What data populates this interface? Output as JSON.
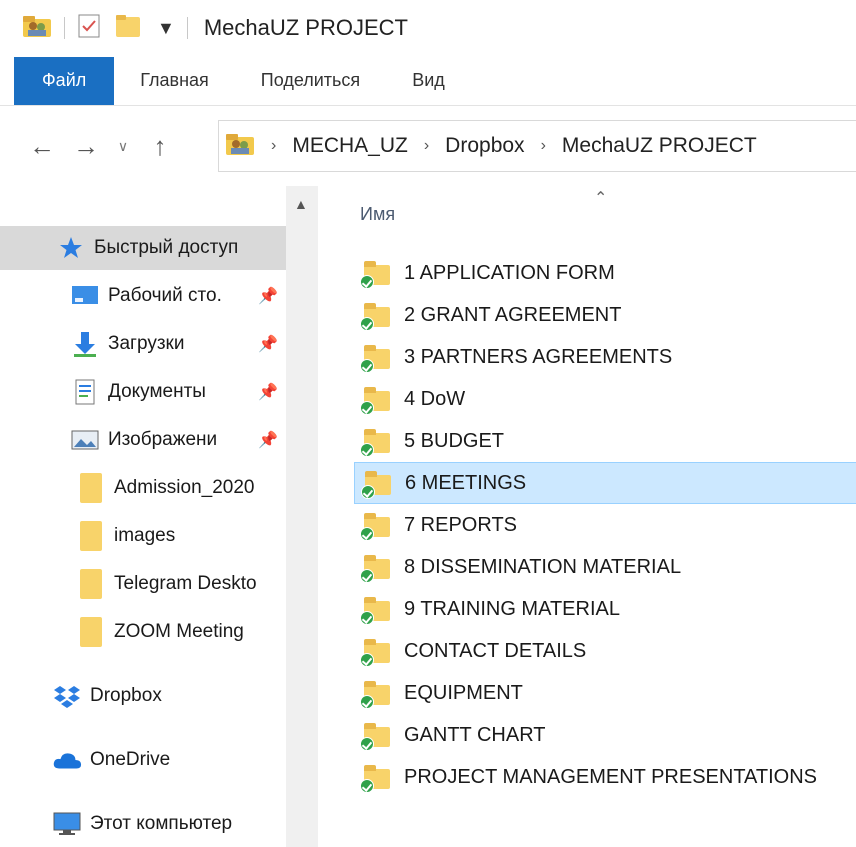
{
  "window": {
    "title": "MechaUZ PROJECT"
  },
  "ribbon": {
    "tabs": [
      "Файл",
      "Главная",
      "Поделиться",
      "Вид"
    ]
  },
  "address": {
    "crumbs": [
      "MECHA_UZ",
      "Dropbox",
      "MechaUZ PROJECT"
    ]
  },
  "nav": {
    "items": [
      {
        "label": "Быстрый доступ",
        "icon": "star-icon",
        "pinned": false,
        "selected": true
      },
      {
        "label": "Рабочий сто.",
        "icon": "desktop-icon",
        "pinned": true
      },
      {
        "label": "Загрузки",
        "icon": "downloads-icon",
        "pinned": true
      },
      {
        "label": "Документы",
        "icon": "documents-icon",
        "pinned": true
      },
      {
        "label": "Изображени",
        "icon": "pictures-icon",
        "pinned": true
      },
      {
        "label": "Admission_2020",
        "icon": "folder-icon",
        "pinned": false
      },
      {
        "label": "images",
        "icon": "folder-icon",
        "pinned": false
      },
      {
        "label": "Telegram Deskto",
        "icon": "folder-icon",
        "pinned": false
      },
      {
        "label": "ZOOM Meeting",
        "icon": "folder-icon",
        "pinned": false
      },
      {
        "label": "Dropbox",
        "icon": "dropbox-icon",
        "pinned": false
      },
      {
        "label": "OneDrive",
        "icon": "onedrive-icon",
        "pinned": false
      },
      {
        "label": "Этот компьютер",
        "icon": "computer-icon",
        "pinned": false
      }
    ]
  },
  "content": {
    "column_header": "Имя",
    "items": [
      "1 APPLICATION FORM",
      "2 GRANT AGREEMENT",
      "3 PARTNERS AGREEMENTS",
      "4 DoW",
      "5 BUDGET",
      "6 MEETINGS",
      "7 REPORTS",
      "8 DISSEMINATION MATERIAL",
      "9 TRAINING MATERIAL",
      "CONTACT DETAILS",
      "EQUIPMENT",
      "GANTT CHART",
      "PROJECT MANAGEMENT PRESENTATIONS"
    ],
    "selected_index": 5
  },
  "colors": {
    "accent": "#1a6fc2",
    "selection": "#cce8ff",
    "folder": "#f8d36a",
    "sync_ok": "#2fa14a"
  }
}
